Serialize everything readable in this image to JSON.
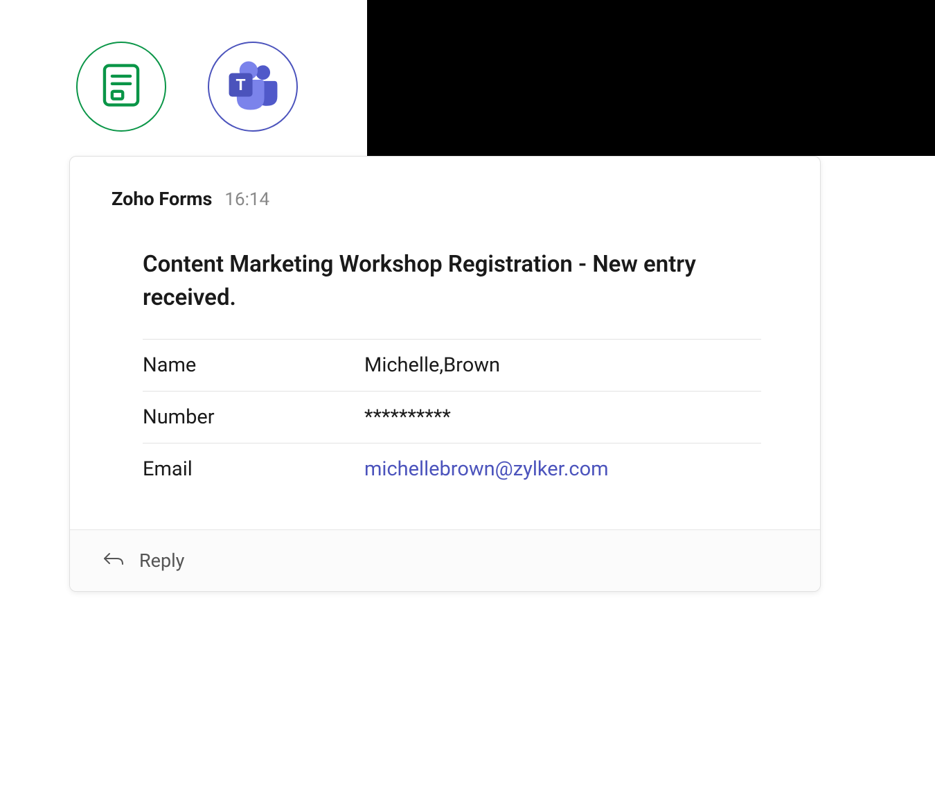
{
  "sender": {
    "name": "Zoho Forms",
    "timestamp": "16:14"
  },
  "message": {
    "title": "Content Marketing Workshop Registration - New entry received.",
    "fields": [
      {
        "label": "Name",
        "value": "Michelle,Brown",
        "type": "text"
      },
      {
        "label": "Number",
        "value": "**********",
        "type": "text"
      },
      {
        "label": "Email",
        "value": "michellebrown@zylker.com",
        "type": "email"
      }
    ]
  },
  "footer": {
    "reply_label": "Reply"
  },
  "icons": {
    "zoho_forms": "zoho-forms-icon",
    "teams": "microsoft-teams-icon",
    "reply": "reply-arrow-icon"
  }
}
